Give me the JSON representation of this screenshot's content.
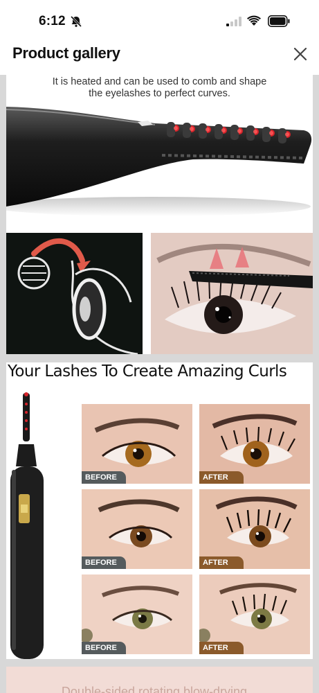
{
  "status_bar": {
    "time": "6:12",
    "icons": [
      "bell-muted-icon",
      "cellular-signal-icon",
      "wifi-icon",
      "battery-icon"
    ]
  },
  "header": {
    "title": "Product gallery",
    "close_icon": "close-icon"
  },
  "gallery": {
    "image_1": {
      "caption_line_1": "It is heated and can be used to comb and shape",
      "caption_line_2": "the eyelashes to perfect curves."
    },
    "image_2": {
      "headline": "Your Lashes To Create Amazing Curls",
      "comparisons": [
        {
          "before": "BEFORE",
          "after": "AFTER"
        },
        {
          "before": "BEFORE",
          "after": "AFTER"
        },
        {
          "before": "BEFORE",
          "after": "AFTER"
        }
      ]
    },
    "image_3": {
      "peek_text": "Double-sided rotating blow-drying..."
    }
  },
  "colors": {
    "accent_red": "#d6232a",
    "after_badge": "#8b5a2b",
    "before_badge": "#555b5d",
    "gallery_bg": "#d8d8d8"
  }
}
